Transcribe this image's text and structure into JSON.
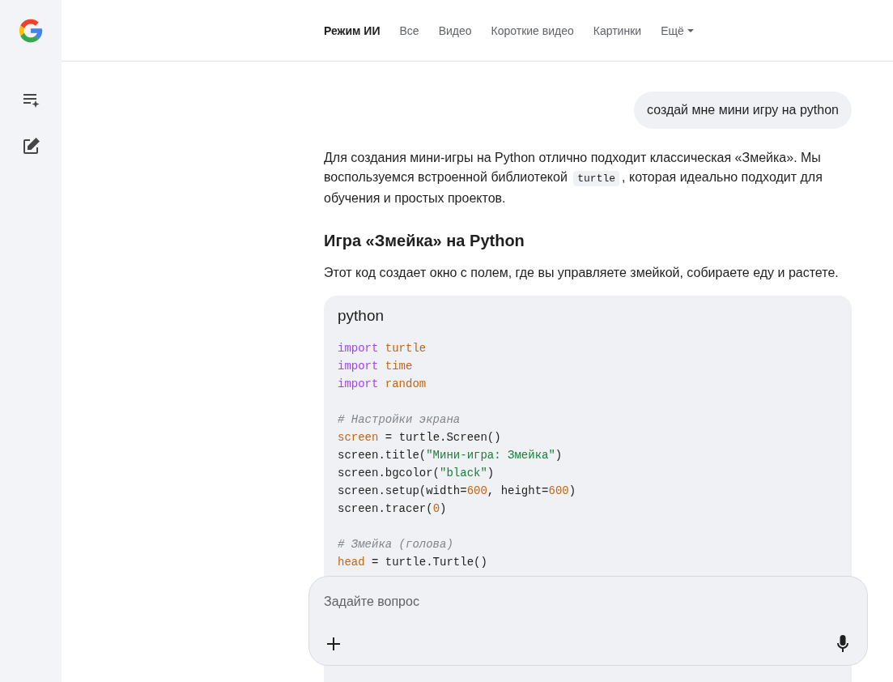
{
  "tabs": [
    {
      "label": "Режим ИИ",
      "selected": true
    },
    {
      "label": "Все",
      "selected": false
    },
    {
      "label": "Видео",
      "selected": false
    },
    {
      "label": "Короткие видео",
      "selected": false
    },
    {
      "label": "Картинки",
      "selected": false
    },
    {
      "label": "Ещё",
      "selected": false,
      "kind": "dropdown"
    }
  ],
  "user_message": "создай мне мини игру на python",
  "answer": {
    "intro": [
      {
        "kind": "text",
        "text": "Для создания мини-игры на Python отлично подходит классическая «Змейка». Мы воспользуемся встроенной библиотекой "
      },
      {
        "kind": "code",
        "text": "turtle"
      },
      {
        "kind": "text",
        "text": ", которая идеально подходит для обучения и простых проектов."
      }
    ],
    "heading": "Игра «Змейка» на Python",
    "description": "Этот код создает окно с полем, где вы управляете змейкой, собираете еду и растете.",
    "code_block": {
      "language": "python",
      "lines": [
        {
          "kind": "code",
          "tokens": [
            {
              "kind": "keyword",
              "text": "import "
            },
            {
              "kind": "name",
              "text": "turtle"
            }
          ]
        },
        {
          "kind": "code",
          "tokens": [
            {
              "kind": "keyword",
              "text": "import "
            },
            {
              "kind": "name",
              "text": "time"
            }
          ]
        },
        {
          "kind": "code",
          "tokens": [
            {
              "kind": "keyword",
              "text": "import "
            },
            {
              "kind": "name",
              "text": "random"
            }
          ]
        },
        {
          "kind": "blank"
        },
        {
          "kind": "code",
          "tokens": [
            {
              "kind": "comment",
              "text": "# Настройки экрана"
            }
          ]
        },
        {
          "kind": "code",
          "tokens": [
            {
              "kind": "name",
              "text": "screen"
            },
            {
              "kind": "plain",
              "text": " = turtle.Screen()"
            }
          ]
        },
        {
          "kind": "code",
          "tokens": [
            {
              "kind": "plain",
              "text": "screen.title("
            },
            {
              "kind": "string",
              "text": "\"Мини-игра: Змейка\""
            },
            {
              "kind": "plain",
              "text": ")"
            }
          ]
        },
        {
          "kind": "code",
          "tokens": [
            {
              "kind": "plain",
              "text": "screen.bgcolor("
            },
            {
              "kind": "string",
              "text": "\"black\""
            },
            {
              "kind": "plain",
              "text": ")"
            }
          ]
        },
        {
          "kind": "code",
          "tokens": [
            {
              "kind": "plain",
              "text": "screen.setup(width="
            },
            {
              "kind": "number",
              "text": "600"
            },
            {
              "kind": "plain",
              "text": ", height="
            },
            {
              "kind": "number",
              "text": "600"
            },
            {
              "kind": "plain",
              "text": ")"
            }
          ]
        },
        {
          "kind": "code",
          "tokens": [
            {
              "kind": "plain",
              "text": "screen.tracer("
            },
            {
              "kind": "number",
              "text": "0"
            },
            {
              "kind": "plain",
              "text": ")"
            }
          ]
        },
        {
          "kind": "blank"
        },
        {
          "kind": "code",
          "tokens": [
            {
              "kind": "comment",
              "text": "# Змейка (голова)"
            }
          ]
        },
        {
          "kind": "code",
          "tokens": [
            {
              "kind": "name",
              "text": "head"
            },
            {
              "kind": "plain",
              "text": " = turtle.Turtle()"
            }
          ]
        }
      ]
    }
  },
  "composer": {
    "placeholder": "Задайте вопрос"
  }
}
